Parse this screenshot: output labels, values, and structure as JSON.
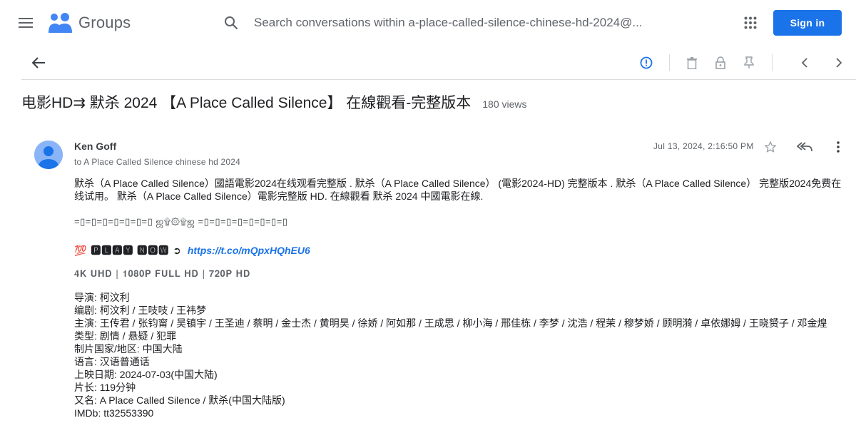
{
  "header": {
    "app_name": "Groups",
    "search_placeholder": "Search conversations within a-place-called-silence-chinese-hd-2024@...",
    "signin_label": "Sign in"
  },
  "thread": {
    "title": "电影HD⇉ 默杀 2024 【A Place Called Silence】 在線觀看-完整版本",
    "views": "180 views"
  },
  "message": {
    "author": "Ken Goff",
    "recipient": "to A Place Called Silence chinese hd 2024",
    "date": "Jul 13, 2024, 2:16:50 PM",
    "intro": "默杀（A Place Called Silence）國語電影2024在线观看完整版 . 默杀（A Place Called Silence） (電影2024-HD) 完整版本 . 默杀（A Place Called Silence） 完整版2024免费在线试用。 默杀（A Place Called Silence）電影完整版 HD. 在線觀看 默杀 2024 中國電影在線.",
    "divider": "=▯=▯=▯=▯=▯=▯=▯ ஜ۩۞۩ஜ =▯=▯=▯=▯=▯=▯=▯=▯",
    "play_prefix": "💯 🅿🅻🅰🆈 🅽🅾🆆 ➲",
    "play_link": "https://t.co/mQpxHQhEU6",
    "quality": "𝟒𝐊 𝐔𝐇𝐃 | 𝟏𝟎𝟖𝟎𝐏 𝐅𝐔𝐋𝐋 𝐇𝐃 | 𝟕𝟐𝟎𝐏 𝐇𝐃",
    "info": [
      "导演: 柯汶利",
      "编剧: 柯汶利 / 王吱吱 / 王祎梦",
      "主演: 王传君 / 张钧甯 / 吴镇宇 / 王圣迪 / 蔡明 / 金士杰 / 黄明昊 / 徐娇 / 阿如那 / 王成思 / 柳小海 / 邢佳栋 / 李梦 / 沈浩 / 程茉 / 穆梦娇 / 顾明漪 / 卓依娜姆 / 王晓赟子 / 邓金煌",
      "类型: 剧情 / 悬疑 / 犯罪",
      "制片国家/地区: 中国大陆",
      "语言: 汉语普通话",
      "上映日期: 2024-07-03(中国大陆)",
      "片长: 119分钟",
      "又名: A Place Called Silence / 默杀(中国大陆版)",
      "IMDb: tt32553390"
    ]
  },
  "colors": {
    "accent": "#1a73e8",
    "icon": "#5f6368",
    "report_icon": "#1a73e8",
    "avatar": "#8ab4f8"
  }
}
